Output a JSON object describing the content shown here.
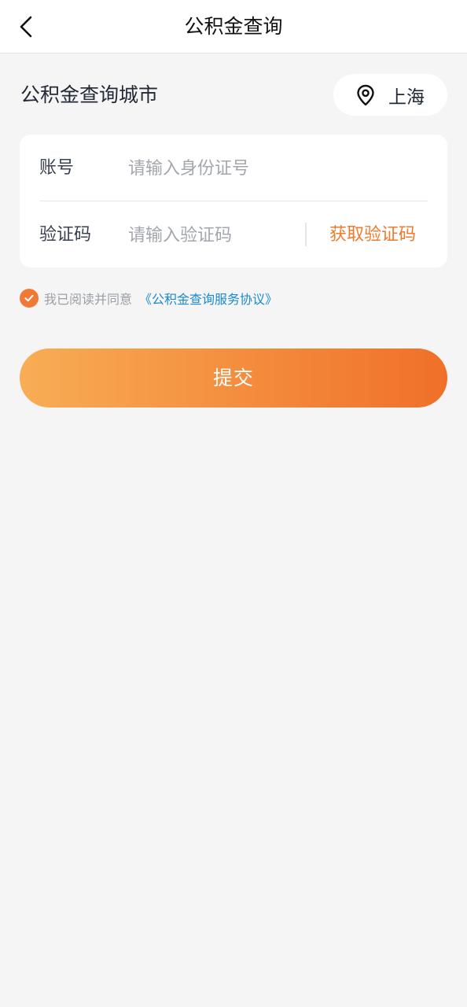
{
  "header": {
    "title": "公积金查询",
    "back_icon": "chevron-left-icon"
  },
  "city": {
    "label": "公积金查询城市",
    "selected": "上海",
    "icon": "location-pin-icon"
  },
  "form": {
    "account": {
      "label": "账号",
      "value": "",
      "placeholder": "请输入身份证号"
    },
    "code": {
      "label": "验证码",
      "value": "",
      "placeholder": "请输入验证码",
      "get_code_label": "获取验证码"
    }
  },
  "agreement": {
    "checked": true,
    "text": "我已阅读并同意",
    "link": "《公积金查询服务协议》"
  },
  "submit_label": "提交",
  "colors": {
    "accent": "#ef7b2e",
    "link": "#1a8ad0",
    "gradient_start": "#f8ad55",
    "gradient_end": "#f07028",
    "background": "#f5f5f5"
  }
}
